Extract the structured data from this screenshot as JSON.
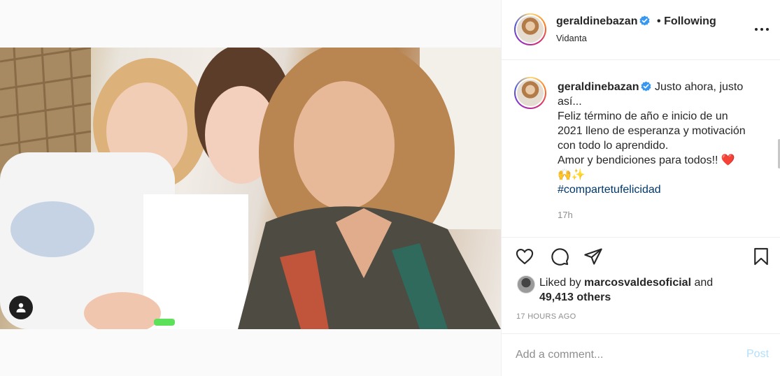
{
  "post": {
    "author": "geraldinebazan",
    "verified": true,
    "follow_separator": "•",
    "follow_status": "Following",
    "location": "Vidanta",
    "caption_lines": [
      "Justo ahora, justo",
      "así...",
      "Feliz término de año e inicio de un",
      "2021 lleno de esperanza y motivación",
      "con todo lo aprendido.",
      "Amor y bendiciones para todos!! ❤️",
      "🙌✨"
    ],
    "hashtag": "#compartetufelicidad",
    "caption_time": "17h",
    "liked_by_prefix": "Liked by",
    "liked_by_user": "marcosvaldesoficial",
    "liked_by_and": "and",
    "liked_by_others": "49,413 others",
    "posted_time": "17 HOURS AGO"
  },
  "comment": {
    "placeholder": "Add a comment...",
    "post_label": "Post"
  },
  "colors": {
    "link": "#00376b",
    "verified": "#3897f0",
    "muted": "#8e8e8e",
    "post_disabled": "#b2dffc",
    "heart": "#ed4956"
  }
}
